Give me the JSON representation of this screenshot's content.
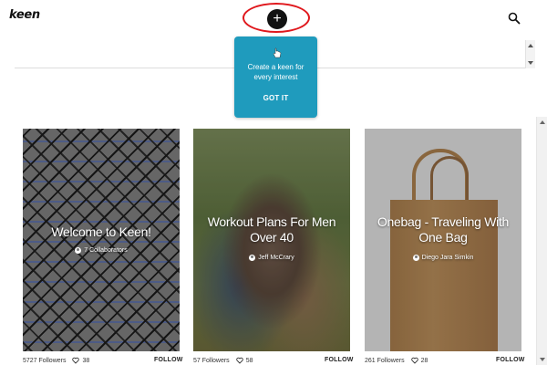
{
  "header": {
    "logo": "keen",
    "add_button": "+"
  },
  "tooltip": {
    "message": "Create a keen for every interest",
    "action": "GOT IT"
  },
  "cards": [
    {
      "title": "Welcome to Keen!",
      "byline": "7 Collaborators",
      "followers": "5727 Followers",
      "likes": "38",
      "follow": "FOLLOW"
    },
    {
      "title": "Workout Plans For Men Over 40",
      "byline": "Jeff McCrary",
      "followers": "57 Followers",
      "likes": "58",
      "follow": "FOLLOW"
    },
    {
      "title": "Onebag - Traveling With One Bag",
      "byline": "Diego Jara Simkin",
      "followers": "261 Followers",
      "likes": "28",
      "follow": "FOLLOW"
    }
  ],
  "colors": {
    "tooltip_bg": "#1f9bbd",
    "highlight": "#e0181d"
  }
}
